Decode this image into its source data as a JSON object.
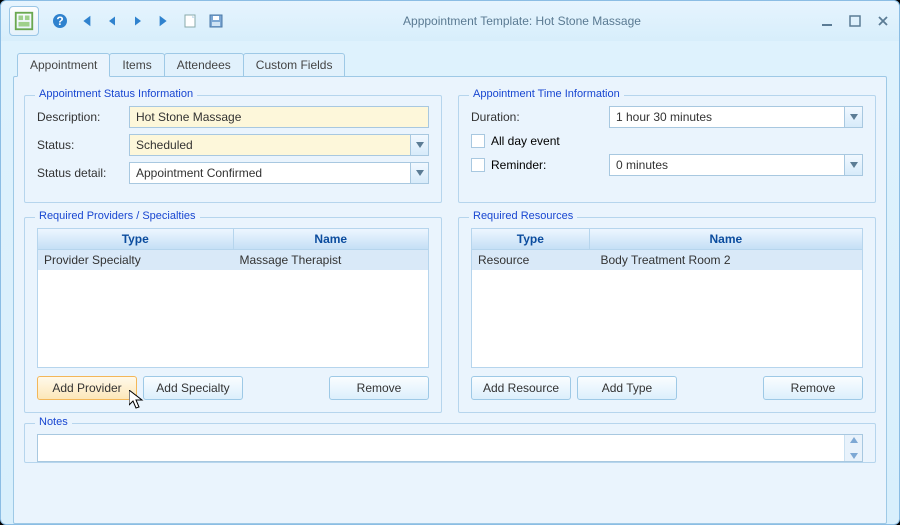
{
  "window": {
    "title": "Apppointment Template: Hot Stone Massage"
  },
  "tabs": [
    "Appointment",
    "Items",
    "Attendees",
    "Custom Fields"
  ],
  "statusGroup": {
    "title": "Appointment Status Information",
    "descLabel": "Description:",
    "descValue": "Hot Stone Massage",
    "statusLabel": "Status:",
    "statusValue": "Scheduled",
    "detailLabel": "Status detail:",
    "detailValue": "Appointment Confirmed"
  },
  "timeGroup": {
    "title": "Appointment Time Information",
    "durationLabel": "Duration:",
    "durationValue": "1 hour 30 minutes",
    "allDayLabel": "All day event",
    "reminderLabel": "Reminder:",
    "reminderValue": "0 minutes"
  },
  "providersGroup": {
    "title": "Required Providers / Specialties",
    "thType": "Type",
    "thName": "Name",
    "rowType": "Provider Specialty",
    "rowName": "Massage Therapist",
    "btnAddProvider": "Add Provider",
    "btnAddSpecialty": "Add Specialty",
    "btnRemove": "Remove"
  },
  "resourcesGroup": {
    "title": "Required Resources",
    "thType": "Type",
    "thName": "Name",
    "rowType": "Resource",
    "rowName": "Body Treatment Room 2",
    "btnAddResource": "Add Resource",
    "btnAddType": "Add Type",
    "btnRemove": "Remove"
  },
  "notesGroup": {
    "title": "Notes"
  }
}
